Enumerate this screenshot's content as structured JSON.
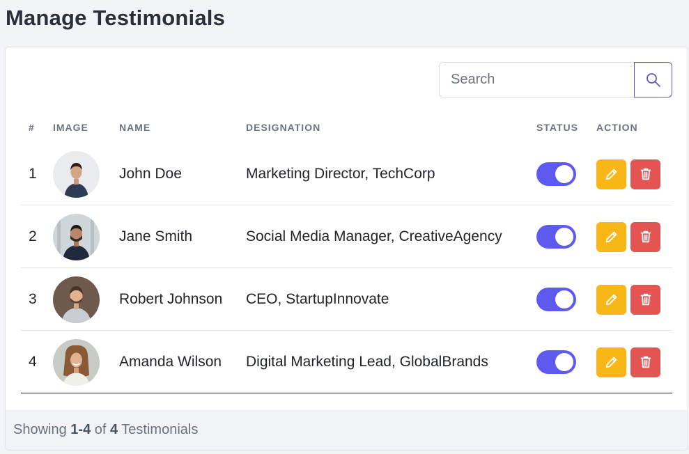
{
  "page": {
    "title": "Manage Testimonials"
  },
  "search": {
    "placeholder": "Search",
    "button_icon": "search-icon"
  },
  "table": {
    "columns": [
      "#",
      "IMAGE",
      "NAME",
      "DESIGNATION",
      "STATUS",
      "ACTION"
    ],
    "rows": [
      {
        "num": "1",
        "name": "John Doe",
        "designation": "Marketing Director, TechCorp",
        "status": true
      },
      {
        "num": "2",
        "name": "Jane Smith",
        "designation": "Social Media Manager, CreativeAgency",
        "status": true
      },
      {
        "num": "3",
        "name": "Robert Johnson",
        "designation": "CEO, StartupInnovate",
        "status": true
      },
      {
        "num": "4",
        "name": "Amanda Wilson",
        "designation": "Digital Marketing Lead, GlobalBrands",
        "status": true
      }
    ]
  },
  "footer": {
    "prefix": "Showing ",
    "range": "1-4",
    "of": " of ",
    "total": "4",
    "suffix": " Testimonials"
  },
  "colors": {
    "accent": "#5f5aef",
    "edit": "#f9b617",
    "delete": "#e35453"
  }
}
